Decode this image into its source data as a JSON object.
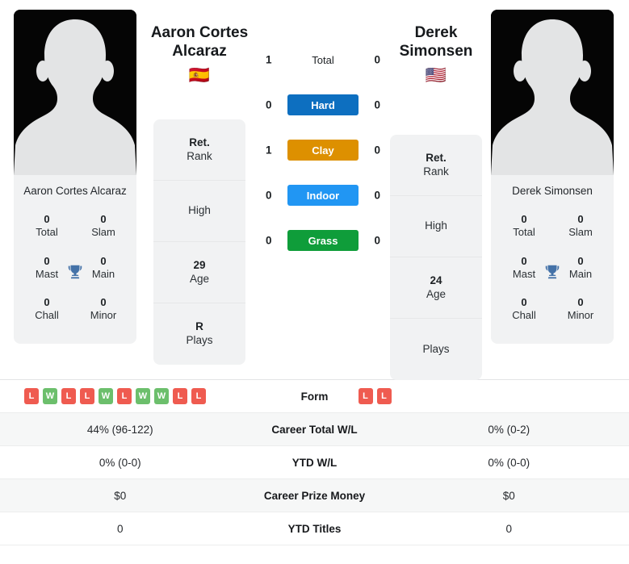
{
  "players": {
    "left": {
      "name": "Aaron Cortes Alcaraz",
      "name_line1": "Aaron Cortes",
      "name_line2": "Alcaraz",
      "flag": "🇪🇸",
      "flag_name": "spain-flag",
      "titles": [
        {
          "value": "0",
          "label": "Total"
        },
        {
          "value": "0",
          "label": "Slam"
        },
        {
          "value": "0",
          "label": "Mast"
        },
        {
          "value": "0",
          "label": "Main"
        },
        {
          "value": "0",
          "label": "Chall"
        },
        {
          "value": "0",
          "label": "Minor"
        }
      ],
      "bio": [
        {
          "value": "Ret.",
          "label": "Rank"
        },
        {
          "value": "",
          "label": "High"
        },
        {
          "value": "29",
          "label": "Age"
        },
        {
          "value": "R",
          "label": "Plays"
        }
      ],
      "form": [
        "L",
        "W",
        "L",
        "L",
        "W",
        "L",
        "W",
        "W",
        "L",
        "L"
      ]
    },
    "right": {
      "name": "Derek Simonsen",
      "name_line1": "Derek",
      "name_line2": "Simonsen",
      "flag": "🇺🇸",
      "flag_name": "usa-flag",
      "titles": [
        {
          "value": "0",
          "label": "Total"
        },
        {
          "value": "0",
          "label": "Slam"
        },
        {
          "value": "0",
          "label": "Mast"
        },
        {
          "value": "0",
          "label": "Main"
        },
        {
          "value": "0",
          "label": "Chall"
        },
        {
          "value": "0",
          "label": "Minor"
        }
      ],
      "bio": [
        {
          "value": "Ret.",
          "label": "Rank"
        },
        {
          "value": "",
          "label": "High"
        },
        {
          "value": "24",
          "label": "Age"
        },
        {
          "value": "",
          "label": "Plays"
        }
      ],
      "form": [
        "L",
        "L"
      ]
    }
  },
  "surfaces": [
    {
      "label": "Total",
      "left": "1",
      "right": "0",
      "color": "",
      "plain": true
    },
    {
      "label": "Hard",
      "left": "0",
      "right": "0",
      "color": "#0d6fc0",
      "plain": false
    },
    {
      "label": "Clay",
      "left": "1",
      "right": "0",
      "color": "#dd9000",
      "plain": false
    },
    {
      "label": "Indoor",
      "left": "0",
      "right": "0",
      "color": "#2196f3",
      "plain": false
    },
    {
      "label": "Grass",
      "left": "0",
      "right": "0",
      "color": "#0f9d3a",
      "plain": false
    }
  ],
  "stats_rows": [
    {
      "label": "Form",
      "left": "",
      "right": "",
      "form": true
    },
    {
      "label": "Career Total W/L",
      "left": "44% (96-122)",
      "right": "0% (0-2)",
      "form": false
    },
    {
      "label": "YTD W/L",
      "left": "0% (0-0)",
      "right": "0% (0-0)",
      "form": false
    },
    {
      "label": "Career Prize Money",
      "left": "$0",
      "right": "$0",
      "form": false
    },
    {
      "label": "YTD Titles",
      "left": "0",
      "right": "0",
      "form": false
    }
  ],
  "colors": {
    "win_badge": "#6cbf6c",
    "loss_badge": "#ef5b50",
    "trophy": "#4472a8",
    "card_bg": "#f1f2f3",
    "avatar_bg": "#050505",
    "silhouette": "#e3e4e5"
  }
}
